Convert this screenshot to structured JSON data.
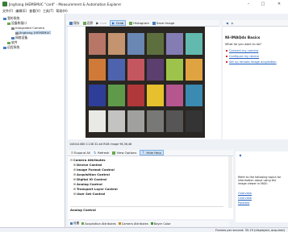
{
  "window": {
    "title": "Jinghang (HEMSMUC \"card\" - Measurement & Automation Explorer",
    "minimize": "–",
    "maximize": "□",
    "close": "✕"
  },
  "menubar": [
    "文件(F)",
    "编辑(E)",
    "查看(V)",
    "工具(T)",
    "帮助(H)"
  ],
  "tree": {
    "root": "我的系统",
    "items": [
      {
        "label": "设备和接口",
        "indent": 1
      },
      {
        "label": "Integrated Camera",
        "indent": 2
      },
      {
        "label": "Jinghang (HEMSMUC",
        "indent": 3,
        "selected": true
      },
      {
        "label": "网络设备",
        "indent": 2
      },
      {
        "label": "软件",
        "indent": 1
      },
      {
        "label": "远程系统",
        "indent": 0
      }
    ]
  },
  "toolbar": {
    "save": "保存",
    "revert": "还原",
    "live": "Live",
    "grab": "Grab",
    "histogram": "Histogram",
    "save_image": "Save Image"
  },
  "viewer": {
    "status": "1440x1080  0.138  32-bit RGB image  96,36,48",
    "swatches": [
      [
        "#b87766",
        "#c3946f",
        "#6a86b2",
        "#5e6f3f",
        "#847db3",
        "#62b9ad"
      ],
      [
        "#d07a3a",
        "#4e63ad",
        "#c4565f",
        "#5c3f6e",
        "#9ec34a",
        "#e0a341"
      ],
      [
        "#2e3e98",
        "#5f9a4b",
        "#b0383a",
        "#e6c02d",
        "#b5568e",
        "#3a8ab1"
      ],
      [
        "#e9e9e6",
        "#c3c4c2",
        "#a0a19f",
        "#787977",
        "#555655",
        "#333433"
      ]
    ]
  },
  "feature_panel": {
    "expand_all": "Expand All",
    "refresh": "Refresh",
    "view_options": "View Options",
    "hide_help": "Hide Help",
    "header": "Camera Attributes",
    "items": [
      "Device Control",
      "Image Format Control",
      "Acquisition Control",
      "Digital IO Control",
      "Analog Control",
      "Transport Layer Control",
      "User Set Control"
    ],
    "footer": "Analog Control"
  },
  "bottom_tabs": {
    "settings": "设置",
    "acq_attrs": "Acquisition Attributes",
    "cam_attrs": "Camera Attributes",
    "bayer": "Bayer Color"
  },
  "help_panel": {
    "title": "NI-IMAQdx Basics",
    "question": "What do you want to do?",
    "links": [
      "Connect my camera",
      "Configure my device",
      "Set up remote image acquisition"
    ],
    "lower_text": "Refer to the following topics for information about using the image viewer in MAX:",
    "lower_links": [
      "Overview",
      "Overview",
      "Palettes"
    ]
  },
  "statusbar": {
    "text": "Frames per second: 35.19 (displayed, acquired)"
  }
}
